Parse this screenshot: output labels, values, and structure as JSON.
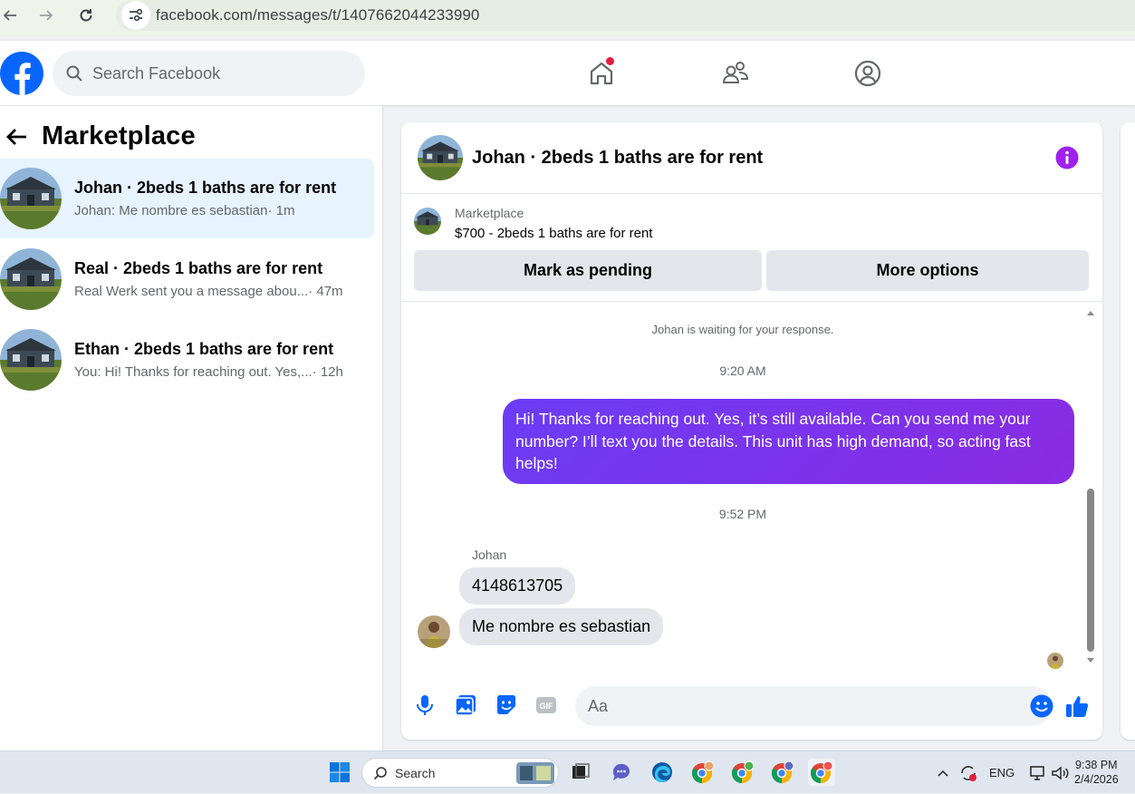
{
  "browser": {
    "url": "facebook.com/messages/t/1407662044233990"
  },
  "header": {
    "search_placeholder": "Search Facebook",
    "nav_icons": [
      "home-icon",
      "friends-icon",
      "profile-icon"
    ]
  },
  "sidebar": {
    "title": "Marketplace",
    "conversations": [
      {
        "title": "Johan · 2beds 1 baths are for rent",
        "snippet": "Johan: Me nombre es sebastian",
        "time": " · 1m",
        "active": true
      },
      {
        "title": "Real · 2beds 1 baths are for rent",
        "snippet": "Real Werk sent you a message abou...",
        "time": " · 47m",
        "active": false
      },
      {
        "title": "Ethan · 2beds 1 baths are for rent",
        "snippet": "You: Hi! Thanks for reaching out. Yes,...",
        "time": " · 12h",
        "active": false
      }
    ]
  },
  "chat": {
    "title": "Johan · 2beds 1 baths are for rent",
    "listing_label": "Marketplace",
    "listing_price": "$700 - 2beds 1 baths are for rent",
    "mark_pending_label": "Mark as pending",
    "more_options_label": "More options",
    "waiting_notice": "Johan is waiting for your response.",
    "time1": "9:20 AM",
    "outgoing_message": "Hi! Thanks for reaching out. Yes, it’s still available. Can you send me your number? I’ll text you the details. This unit has high demand, so acting fast helps!",
    "time2": "9:52 PM",
    "sender_name": "Johan",
    "incoming_messages": [
      "4148613705",
      "Me nombre es sebastian"
    ],
    "composer_placeholder": "Aa"
  },
  "taskbar": {
    "search_label": "Search",
    "language": "ENG",
    "time": "9:38 PM",
    "date": "2/4/2026"
  },
  "colors": {
    "accent": "#0866ff",
    "bubble": "#7b2ff7",
    "info": "#a020f0"
  }
}
